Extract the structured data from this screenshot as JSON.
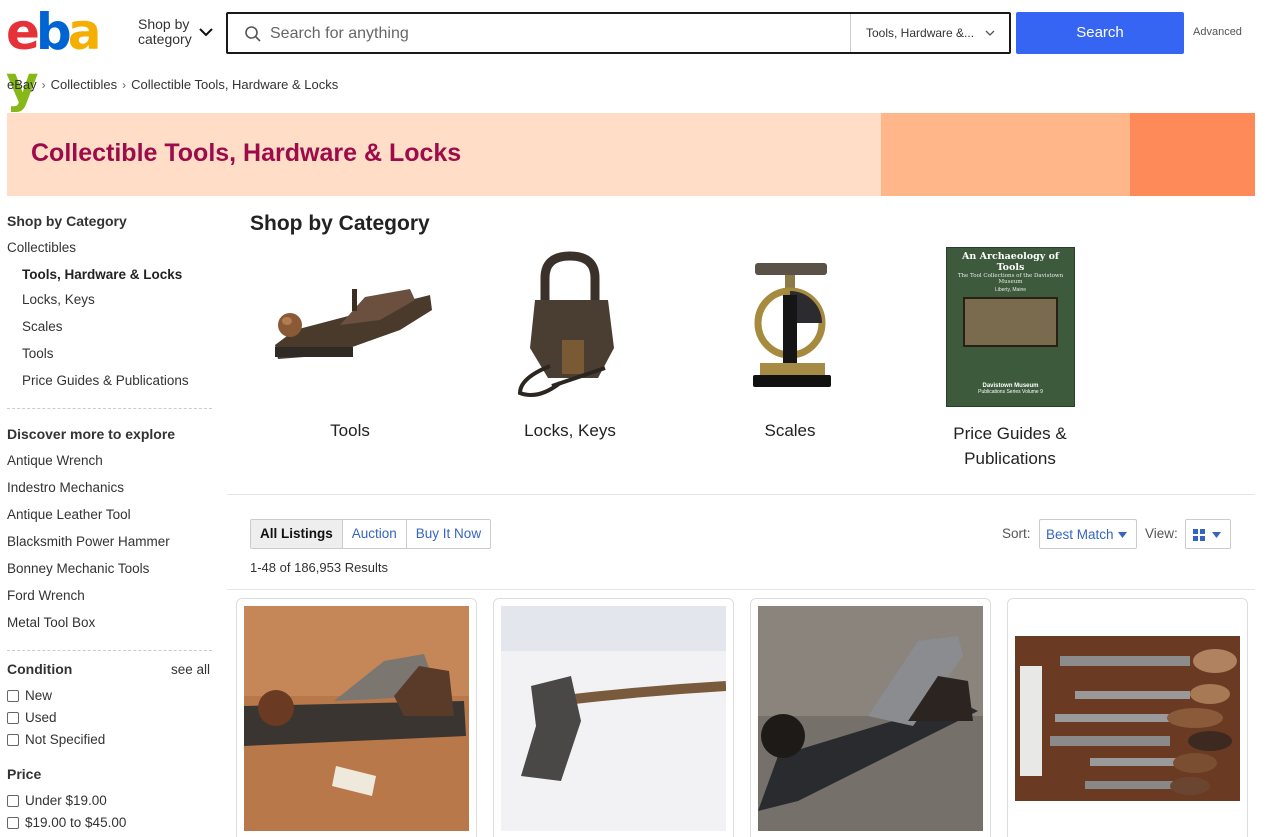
{
  "header": {
    "logo": [
      "e",
      "b",
      "a",
      "y"
    ],
    "logo_colors": [
      "#e53238",
      "#0064d2",
      "#f5af02",
      "#86b817"
    ],
    "shop_by_line1": "Shop by",
    "shop_by_line2": "category",
    "search_placeholder": "Search for anything",
    "category_select": "Tools, Hardware &...",
    "search_button": "Search",
    "advanced": "Advanced"
  },
  "breadcrumb": [
    "eBay",
    "Collectibles",
    "Collectible Tools, Hardware & Locks"
  ],
  "banner": {
    "title": "Collectible Tools, Hardware & Locks",
    "colors": [
      "#ffddc7",
      "#ffb789",
      "#ff8a59"
    ]
  },
  "sidebar": {
    "shop_by_category": "Shop by Category",
    "parent": "Collectibles",
    "current": "Tools, Hardware & Locks",
    "categories": [
      "Locks, Keys",
      "Scales",
      "Tools",
      "Price Guides & Publications"
    ],
    "discover_heading": "Discover more to explore",
    "discover": [
      "Antique Wrench",
      "Indestro Mechanics",
      "Antique Leather Tool",
      "Blacksmith Power Hammer",
      "Bonney Mechanic Tools",
      "Ford Wrench",
      "Metal Tool Box"
    ],
    "condition_heading": "Condition",
    "see_all": "see all",
    "conditions": [
      "New",
      "Used",
      "Not Specified"
    ],
    "price_heading": "Price",
    "prices": [
      "Under $19.00",
      "$19.00 to $45.00"
    ]
  },
  "main": {
    "title": "Shop by Category",
    "categories": [
      {
        "line1": "Tools",
        "line2": ""
      },
      {
        "line1": "Locks, Keys",
        "line2": ""
      },
      {
        "line1": "Scales",
        "line2": ""
      },
      {
        "line1": "Price Guides &",
        "line2": "Publications"
      }
    ],
    "book_title": "An Archaeology of Tools",
    "book_subtitle": "The Tool Collections of the Davistown Museum",
    "book_place": "Liberty, Maine",
    "book_publisher": "Davistown Museum",
    "book_series": "Publications Series Volume 9"
  },
  "listing_controls": {
    "tabs": [
      "All Listings",
      "Auction",
      "Buy It Now"
    ],
    "active_tab": "All Listings",
    "results": "1-48 of 186,953 Results",
    "sort_label": "Sort:",
    "sort_value": "Best Match",
    "view_label": "View:"
  },
  "accent_color": "#3665f3"
}
